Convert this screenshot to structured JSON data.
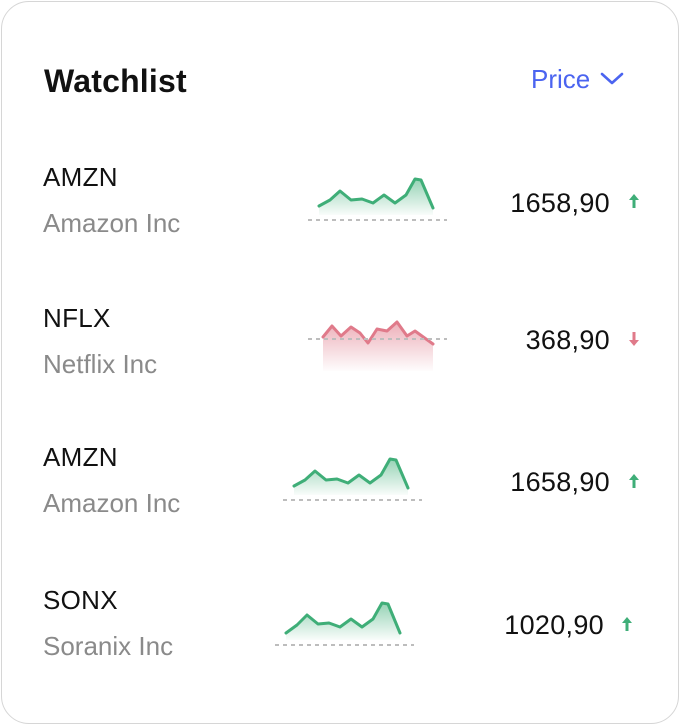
{
  "header": {
    "title": "Watchlist",
    "sort_label": "Price",
    "accent_color": "#4b64f0",
    "sort_icon": "chevron-down-icon"
  },
  "colors": {
    "up": "#3fae78",
    "down": "#e07a8a",
    "baseline": "#bdbdbd"
  },
  "rows": [
    {
      "ticker": "AMZN",
      "company": "Amazon Inc",
      "price": "1658,90",
      "trend": "up",
      "trend_icon": "arrow-up-icon"
    },
    {
      "ticker": "NFLX",
      "company": "Netflix Inc",
      "price": "368,90",
      "trend": "down",
      "trend_icon": "arrow-down-icon"
    },
    {
      "ticker": "AMZN",
      "company": "Amazon Inc",
      "price": "1658,90",
      "trend": "up",
      "trend_icon": "arrow-up-icon"
    },
    {
      "ticker": "SONX",
      "company": "Soranix Inc",
      "price": "1020,90",
      "trend": "up",
      "trend_icon": "arrow-up-icon"
    }
  ]
}
